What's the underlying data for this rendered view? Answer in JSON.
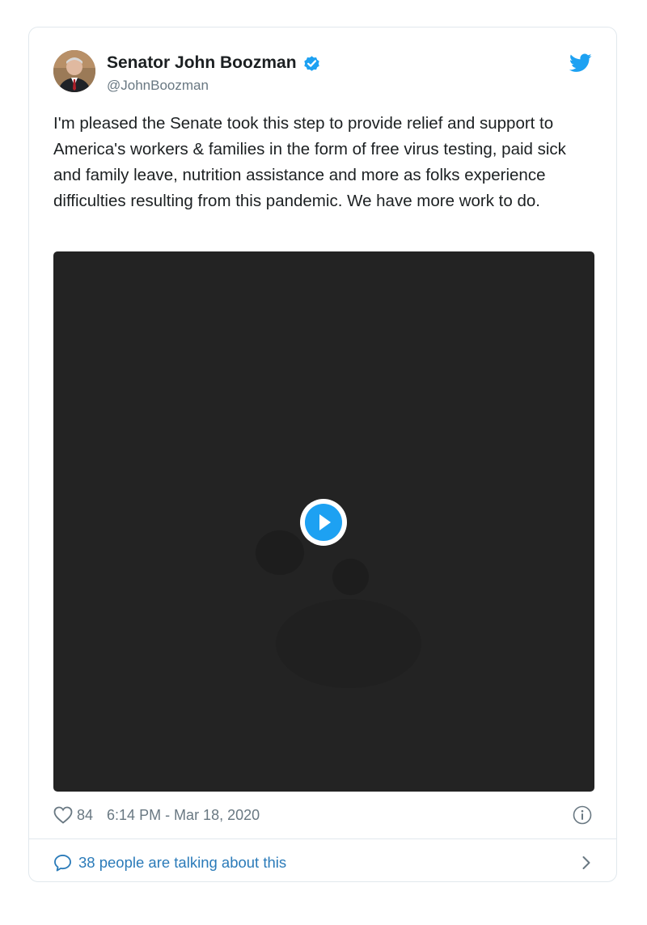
{
  "tweet": {
    "display_name": "Senator John Boozman",
    "handle": "@JohnBoozman",
    "text": "I'm pleased the Senate took this step to provide relief and support to America's workers & families in the form of free virus testing, paid sick and family leave, nutrition assistance and more as folks experience difficulties resulting from this pandemic. We have more work to do.",
    "likes": "84",
    "timestamp": "6:14 PM - Mar 18, 2020",
    "talking": "38 people are talking about this"
  },
  "icons": {
    "verified": "verified-badge-icon",
    "brand": "twitter-bird-icon",
    "like": "heart-outline-icon",
    "info": "info-icon",
    "reply": "speech-bubble-icon",
    "chevron": "chevron-right-icon",
    "play": "play-icon"
  },
  "colors": {
    "accent": "#1da1f2",
    "link": "#2b7bb9",
    "muted": "#697882",
    "media_bg": "#232323"
  }
}
